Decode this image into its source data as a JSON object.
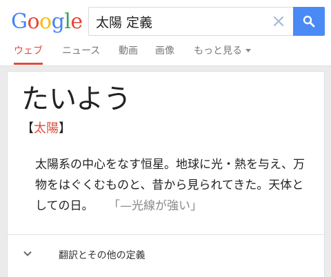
{
  "logo": {
    "letters": [
      "G",
      "o",
      "o",
      "g",
      "l",
      "e"
    ],
    "colors": [
      "#4285f4",
      "#ea4335",
      "#fbbc05",
      "#4285f4",
      "#34a853",
      "#ea4335"
    ]
  },
  "search": {
    "query": "太陽 定義",
    "clear_icon": "×",
    "button_icon": "search-icon",
    "button_color": "#4a8af4"
  },
  "tabs": [
    {
      "label": "ウェブ",
      "active": true
    },
    {
      "label": "ニュース",
      "active": false
    },
    {
      "label": "動画",
      "active": false
    },
    {
      "label": "画像",
      "active": false
    },
    {
      "label": "もっと見る",
      "active": false
    }
  ],
  "accent_color": "#dd4b39",
  "dictionary": {
    "headword": "たいよう",
    "bracket_open": "【",
    "kanji": "太陽",
    "bracket_close": "】",
    "definition": "太陽系の中心をなす恒星。地球に光・熱を与え、万物をはぐくむものと、昔から見られてきた。天体としての日。",
    "example": "「—光線が強い」",
    "more_label": "翻訳とその他の定義"
  }
}
